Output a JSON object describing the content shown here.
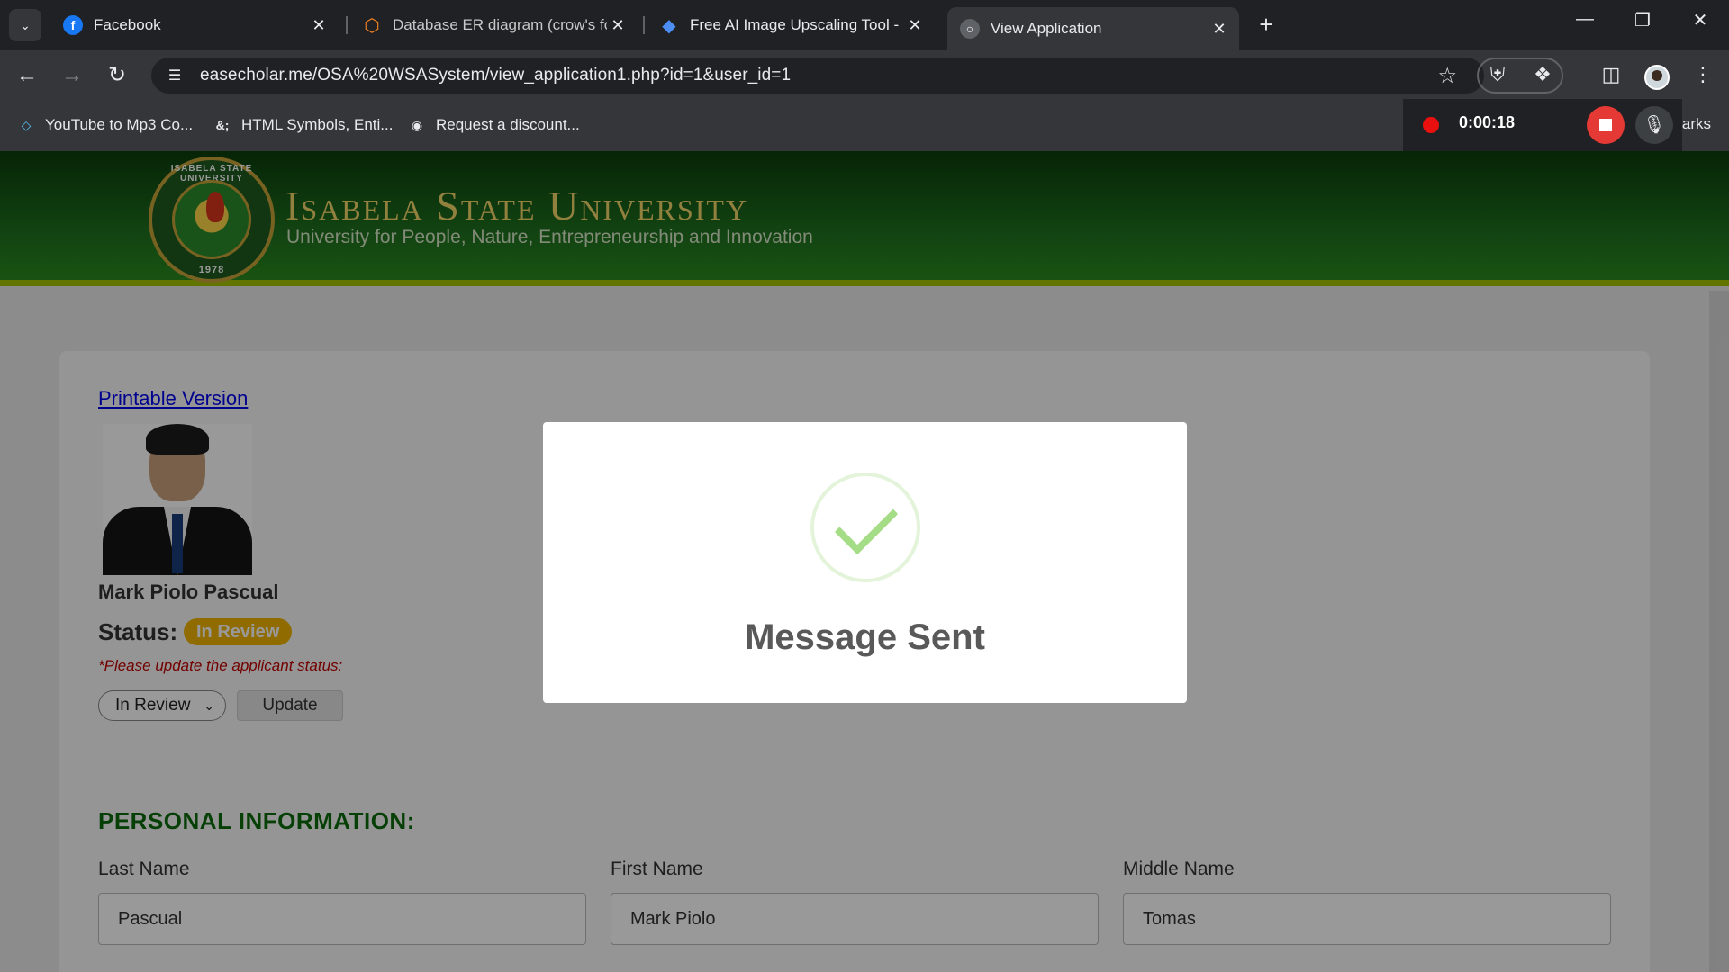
{
  "browser": {
    "tabs": [
      {
        "title": "Facebook",
        "icon": "facebook-icon",
        "active": false
      },
      {
        "title": "Database ER diagram (crow's fo",
        "icon": "diagram-app-icon",
        "active": false
      },
      {
        "title": "Free AI Image Upscaling Tool - ",
        "icon": "gem-icon",
        "active": false
      },
      {
        "title": "View Application",
        "icon": "globe-icon",
        "active": true
      }
    ],
    "url": "easecholar.me/OSA%20WSASystem/view_application1.php?id=1&user_id=1",
    "bookmarks": [
      {
        "label": "YouTube to Mp3 Co...",
        "icon": "diamond-icon"
      },
      {
        "label": "HTML Symbols, Enti...",
        "icon": "ampersand-icon",
        "icon_text": "&;"
      },
      {
        "label": "Request a discount...",
        "icon": "github-icon"
      }
    ],
    "bookmarks_overflow": "arks",
    "recording": {
      "time": "0:00:18"
    }
  },
  "site": {
    "university_name": "Isabela State University",
    "tagline": "University for People, Nature, Entrepreneurship and Innovation",
    "seal_ring_text": "ISABELA STATE UNIVERSITY",
    "seal_year": "1978"
  },
  "application": {
    "printable_link": "Printable Version",
    "applicant_name": "Mark Piolo Pascual",
    "status_label": "Status:",
    "status_badge": "In Review",
    "status_hint": "*Please update the applicant status:",
    "status_select_value": "In Review",
    "update_button": "Update",
    "section_title": "PERSONAL INFORMATION:",
    "fields": [
      {
        "label": "Last Name",
        "value": "Pascual"
      },
      {
        "label": "First Name",
        "value": "Mark Piolo"
      },
      {
        "label": "Middle Name",
        "value": "Tomas"
      }
    ]
  },
  "modal": {
    "title": "Message Sent",
    "icon": "success-check-icon"
  },
  "colors": {
    "brand_green": "#1e6e1e",
    "badge_yellow": "#f0b400",
    "success_green": "#a5dc86",
    "hint_red": "#c00000"
  }
}
